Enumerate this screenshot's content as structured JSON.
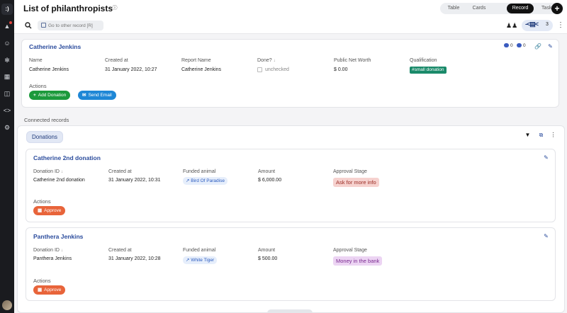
{
  "header": {
    "title": "List of philanthropists",
    "views": [
      "Table",
      "Cards",
      "Record",
      "Tasks"
    ],
    "active_view": "Record"
  },
  "toolbar": {
    "goto_placeholder": "Go to other record [R]",
    "related_count": "3"
  },
  "record": {
    "title": "Catherine Jenkins",
    "comment_count": "0",
    "activity_count": "0",
    "fields": [
      {
        "label": "Name",
        "value": "Catherine Jenkins"
      },
      {
        "label": "Created at",
        "value": "31 January 2022, 10:27"
      },
      {
        "label": "Report Name",
        "value": "Catherine Jenkins"
      },
      {
        "label": "Done?",
        "value": "unchecked"
      },
      {
        "label": "Public Net Worth",
        "value": "$ 0.00"
      },
      {
        "label": "Qualification",
        "value": "#small donation"
      }
    ],
    "actions_label": "Actions",
    "actions": [
      "Add Donation",
      "Send Email"
    ]
  },
  "connected": {
    "section_label": "Connected records",
    "tab_label": "Donations",
    "records": [
      {
        "title": "Catherine 2nd donation",
        "fields": [
          {
            "label": "Donation ID",
            "value": "Catherine 2nd donation"
          },
          {
            "label": "Created at",
            "value": "31 January 2022, 10:31"
          },
          {
            "label": "Funded animal",
            "value": "Bird Of Paradise"
          },
          {
            "label": "Amount",
            "value": "$ 6,000.00"
          },
          {
            "label": "Approval Stage",
            "value": "Ask for more info"
          }
        ],
        "actions_label": "Actions",
        "action": "Approve"
      },
      {
        "title": "Panthera Jenkins",
        "fields": [
          {
            "label": "Donation ID",
            "value": "Panthera Jenkins"
          },
          {
            "label": "Created at",
            "value": "31 January 2022, 10:28"
          },
          {
            "label": "Funded animal",
            "value": "White Tiger"
          },
          {
            "label": "Amount",
            "value": "$ 500.00"
          },
          {
            "label": "Approval Stage",
            "value": "Money in the bank"
          }
        ],
        "actions_label": "Actions",
        "action": "Approve"
      }
    ]
  },
  "colors": {
    "accent": "#2a4b9c",
    "rail": "#1a1b1f",
    "green": "#1c9a3c",
    "blue": "#1e87d6",
    "orange": "#e8643a",
    "qualification": "#1a8a6a"
  }
}
